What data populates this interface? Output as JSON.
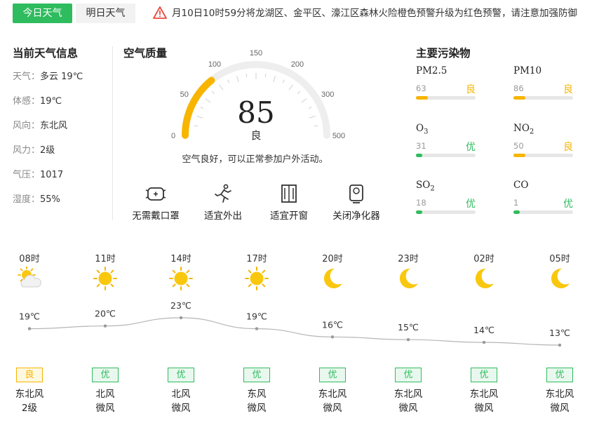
{
  "tabs": {
    "today": "今日天气",
    "tomorrow": "明日天气"
  },
  "warning": {
    "text": "月10日10时59分将龙湖区、金平区、濠江区森林火险橙色预警升级为红色预警，请注意加强防御",
    "icon": "warning-triangle-icon",
    "color": "#e84a3c"
  },
  "current": {
    "title": "当前天气信息",
    "weather_label": "天气：",
    "weather_value": "多云 19℃",
    "feels_label": "体感：",
    "feels_value": "19℃",
    "wind_dir_label": "风向：",
    "wind_dir_value": "东北风",
    "wind_force_label": "风力：",
    "wind_force_value": "2级",
    "pressure_label": "气压：",
    "pressure_value": "1017",
    "humidity_label": "湿度：",
    "humidity_value": "55%"
  },
  "air": {
    "title": "空气质量",
    "aqi": "85",
    "aqi_value": 85,
    "aqi_max": 500,
    "level": "良",
    "description": "空气良好，可以正常参加户外活动。",
    "scale": [
      "0",
      "50",
      "100",
      "150",
      "200",
      "300",
      "500"
    ],
    "colors": {
      "fill": "#f7b500",
      "track": "#eeeeee"
    },
    "tips": [
      {
        "icon": "mask-icon",
        "label": "无需戴口罩"
      },
      {
        "icon": "running-person-icon",
        "label": "适宜外出"
      },
      {
        "icon": "window-icon",
        "label": "适宜开窗"
      },
      {
        "icon": "air-purifier-icon",
        "label": "关闭净化器"
      }
    ]
  },
  "pollutants": {
    "title": "主要污染物",
    "items": [
      {
        "name": "PM2.5",
        "sub": "",
        "value": "63",
        "level": "良",
        "pct": 0.2,
        "color": "#f7b500"
      },
      {
        "name": "PM10",
        "sub": "",
        "value": "86",
        "level": "良",
        "pct": 0.2,
        "color": "#f7b500"
      },
      {
        "name": "O",
        "sub": "3",
        "value": "31",
        "level": "优",
        "pct": 0.1,
        "color": "#2fbc5e"
      },
      {
        "name": "NO",
        "sub": "2",
        "value": "50",
        "level": "良",
        "pct": 0.2,
        "color": "#f7b500"
      },
      {
        "name": "SO",
        "sub": "2",
        "value": "18",
        "level": "优",
        "pct": 0.1,
        "color": "#2fbc5e"
      },
      {
        "name": "CO",
        "sub": "",
        "value": "1",
        "level": "优",
        "pct": 0.1,
        "color": "#2fbc5e"
      }
    ]
  },
  "hourly": [
    {
      "time": "08时",
      "icon": "partly-cloudy-icon",
      "temp": "19℃",
      "temp_value": 19,
      "aqi": "良",
      "aqi_color": "#f7b500",
      "wind_dir": "东北风",
      "wind_force": "2级"
    },
    {
      "time": "11时",
      "icon": "sun-icon",
      "temp": "20℃",
      "temp_value": 20,
      "aqi": "优",
      "aqi_color": "#2fbc5e",
      "wind_dir": "北风",
      "wind_force": "微风"
    },
    {
      "time": "14时",
      "icon": "sun-icon",
      "temp": "23℃",
      "temp_value": 23,
      "aqi": "优",
      "aqi_color": "#2fbc5e",
      "wind_dir": "北风",
      "wind_force": "微风"
    },
    {
      "time": "17时",
      "icon": "sun-icon",
      "temp": "19℃",
      "temp_value": 19,
      "aqi": "优",
      "aqi_color": "#2fbc5e",
      "wind_dir": "东风",
      "wind_force": "微风"
    },
    {
      "time": "20时",
      "icon": "moon-icon",
      "temp": "16℃",
      "temp_value": 16,
      "aqi": "优",
      "aqi_color": "#2fbc5e",
      "wind_dir": "东北风",
      "wind_force": "微风"
    },
    {
      "time": "23时",
      "icon": "moon-icon",
      "temp": "15℃",
      "temp_value": 15,
      "aqi": "优",
      "aqi_color": "#2fbc5e",
      "wind_dir": "东北风",
      "wind_force": "微风"
    },
    {
      "time": "02时",
      "icon": "moon-icon",
      "temp": "14℃",
      "temp_value": 14,
      "aqi": "优",
      "aqi_color": "#2fbc5e",
      "wind_dir": "东北风",
      "wind_force": "微风"
    },
    {
      "time": "05时",
      "icon": "moon-icon",
      "temp": "13℃",
      "temp_value": 13,
      "aqi": "优",
      "aqi_color": "#2fbc5e",
      "wind_dir": "东北风",
      "wind_force": "微风"
    }
  ]
}
